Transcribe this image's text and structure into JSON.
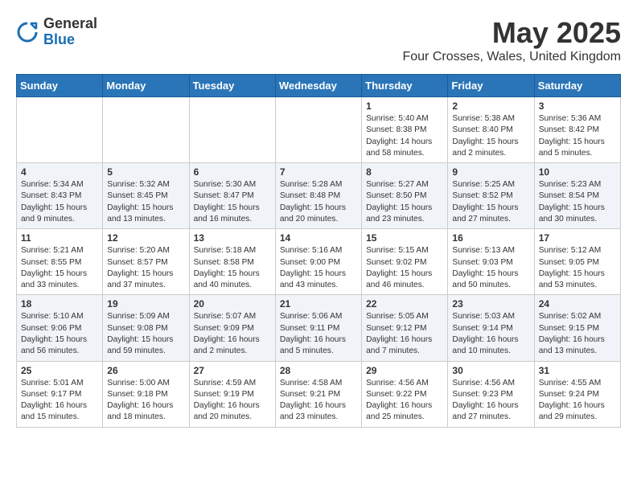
{
  "header": {
    "logo_general": "General",
    "logo_blue": "Blue",
    "month_title": "May 2025",
    "location": "Four Crosses, Wales, United Kingdom"
  },
  "weekdays": [
    "Sunday",
    "Monday",
    "Tuesday",
    "Wednesday",
    "Thursday",
    "Friday",
    "Saturday"
  ],
  "weeks": [
    [
      {
        "day": "",
        "info": ""
      },
      {
        "day": "",
        "info": ""
      },
      {
        "day": "",
        "info": ""
      },
      {
        "day": "",
        "info": ""
      },
      {
        "day": "1",
        "info": "Sunrise: 5:40 AM\nSunset: 8:38 PM\nDaylight: 14 hours\nand 58 minutes."
      },
      {
        "day": "2",
        "info": "Sunrise: 5:38 AM\nSunset: 8:40 PM\nDaylight: 15 hours\nand 2 minutes."
      },
      {
        "day": "3",
        "info": "Sunrise: 5:36 AM\nSunset: 8:42 PM\nDaylight: 15 hours\nand 5 minutes."
      }
    ],
    [
      {
        "day": "4",
        "info": "Sunrise: 5:34 AM\nSunset: 8:43 PM\nDaylight: 15 hours\nand 9 minutes."
      },
      {
        "day": "5",
        "info": "Sunrise: 5:32 AM\nSunset: 8:45 PM\nDaylight: 15 hours\nand 13 minutes."
      },
      {
        "day": "6",
        "info": "Sunrise: 5:30 AM\nSunset: 8:47 PM\nDaylight: 15 hours\nand 16 minutes."
      },
      {
        "day": "7",
        "info": "Sunrise: 5:28 AM\nSunset: 8:48 PM\nDaylight: 15 hours\nand 20 minutes."
      },
      {
        "day": "8",
        "info": "Sunrise: 5:27 AM\nSunset: 8:50 PM\nDaylight: 15 hours\nand 23 minutes."
      },
      {
        "day": "9",
        "info": "Sunrise: 5:25 AM\nSunset: 8:52 PM\nDaylight: 15 hours\nand 27 minutes."
      },
      {
        "day": "10",
        "info": "Sunrise: 5:23 AM\nSunset: 8:54 PM\nDaylight: 15 hours\nand 30 minutes."
      }
    ],
    [
      {
        "day": "11",
        "info": "Sunrise: 5:21 AM\nSunset: 8:55 PM\nDaylight: 15 hours\nand 33 minutes."
      },
      {
        "day": "12",
        "info": "Sunrise: 5:20 AM\nSunset: 8:57 PM\nDaylight: 15 hours\nand 37 minutes."
      },
      {
        "day": "13",
        "info": "Sunrise: 5:18 AM\nSunset: 8:58 PM\nDaylight: 15 hours\nand 40 minutes."
      },
      {
        "day": "14",
        "info": "Sunrise: 5:16 AM\nSunset: 9:00 PM\nDaylight: 15 hours\nand 43 minutes."
      },
      {
        "day": "15",
        "info": "Sunrise: 5:15 AM\nSunset: 9:02 PM\nDaylight: 15 hours\nand 46 minutes."
      },
      {
        "day": "16",
        "info": "Sunrise: 5:13 AM\nSunset: 9:03 PM\nDaylight: 15 hours\nand 50 minutes."
      },
      {
        "day": "17",
        "info": "Sunrise: 5:12 AM\nSunset: 9:05 PM\nDaylight: 15 hours\nand 53 minutes."
      }
    ],
    [
      {
        "day": "18",
        "info": "Sunrise: 5:10 AM\nSunset: 9:06 PM\nDaylight: 15 hours\nand 56 minutes."
      },
      {
        "day": "19",
        "info": "Sunrise: 5:09 AM\nSunset: 9:08 PM\nDaylight: 15 hours\nand 59 minutes."
      },
      {
        "day": "20",
        "info": "Sunrise: 5:07 AM\nSunset: 9:09 PM\nDaylight: 16 hours\nand 2 minutes."
      },
      {
        "day": "21",
        "info": "Sunrise: 5:06 AM\nSunset: 9:11 PM\nDaylight: 16 hours\nand 5 minutes."
      },
      {
        "day": "22",
        "info": "Sunrise: 5:05 AM\nSunset: 9:12 PM\nDaylight: 16 hours\nand 7 minutes."
      },
      {
        "day": "23",
        "info": "Sunrise: 5:03 AM\nSunset: 9:14 PM\nDaylight: 16 hours\nand 10 minutes."
      },
      {
        "day": "24",
        "info": "Sunrise: 5:02 AM\nSunset: 9:15 PM\nDaylight: 16 hours\nand 13 minutes."
      }
    ],
    [
      {
        "day": "25",
        "info": "Sunrise: 5:01 AM\nSunset: 9:17 PM\nDaylight: 16 hours\nand 15 minutes."
      },
      {
        "day": "26",
        "info": "Sunrise: 5:00 AM\nSunset: 9:18 PM\nDaylight: 16 hours\nand 18 minutes."
      },
      {
        "day": "27",
        "info": "Sunrise: 4:59 AM\nSunset: 9:19 PM\nDaylight: 16 hours\nand 20 minutes."
      },
      {
        "day": "28",
        "info": "Sunrise: 4:58 AM\nSunset: 9:21 PM\nDaylight: 16 hours\nand 23 minutes."
      },
      {
        "day": "29",
        "info": "Sunrise: 4:56 AM\nSunset: 9:22 PM\nDaylight: 16 hours\nand 25 minutes."
      },
      {
        "day": "30",
        "info": "Sunrise: 4:56 AM\nSunset: 9:23 PM\nDaylight: 16 hours\nand 27 minutes."
      },
      {
        "day": "31",
        "info": "Sunrise: 4:55 AM\nSunset: 9:24 PM\nDaylight: 16 hours\nand 29 minutes."
      }
    ]
  ]
}
